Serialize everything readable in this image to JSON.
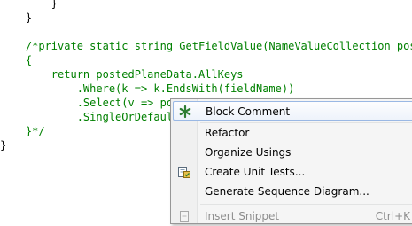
{
  "editor": {
    "lines": [
      {
        "text": "        }",
        "color": "#000000"
      },
      {
        "text": "    }",
        "color": "#000000"
      },
      {
        "text": "",
        "color": "#000000"
      },
      {
        "text": "    /*private static string GetFieldValue(NameValueCollection post",
        "color": "#008000"
      },
      {
        "text": "    {",
        "color": "#008000"
      },
      {
        "text": "        return postedPlaneData.AllKeys",
        "color": "#008000"
      },
      {
        "text": "            .Where(k => k.EndsWith(fieldName))",
        "color": "#008000"
      },
      {
        "text": "            .Select(v => po",
        "color": "#008000"
      },
      {
        "text": "            .SingleOrDefaul",
        "color": "#008000"
      },
      {
        "text": "    }*/",
        "color": "#008000"
      },
      {
        "text": "}",
        "color": "#000000"
      }
    ]
  },
  "context_menu": {
    "items": [
      {
        "label": "Block Comment",
        "icon": "block-comment-icon",
        "selected": true
      },
      {
        "label": "Refactor"
      },
      {
        "label": "Organize Usings"
      },
      {
        "label": "Create Unit Tests...",
        "icon": "unit-test-icon"
      },
      {
        "label": "Generate Sequence Diagram..."
      },
      {
        "label": "Insert Snippet",
        "shortcut": "Ctrl+K",
        "icon": "snippet-icon",
        "disabled": true
      }
    ]
  },
  "colors": {
    "code_text": "#000000",
    "comment": "#008000",
    "menu_background": "#f5f5f5",
    "menu_highlight_border": "#9ab8e4",
    "icon_green": "#2e7d32"
  }
}
